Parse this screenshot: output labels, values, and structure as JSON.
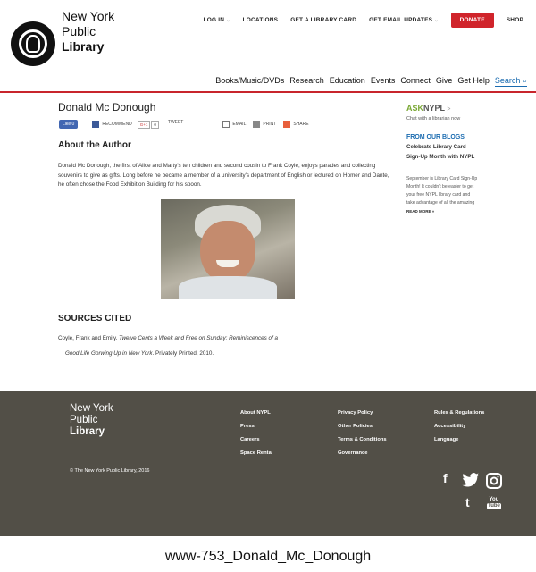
{
  "header": {
    "logo": {
      "line1": "New York",
      "line2": "Public",
      "line3": "Library"
    },
    "topnav": {
      "login": "LOG IN",
      "locations": "LOCATIONS",
      "library_card": "GET A LIBRARY CARD",
      "email_updates": "GET EMAIL UPDATES",
      "donate": "DONATE",
      "shop": "SHOP"
    },
    "mainnav": [
      "Books/Music/DVDs",
      "Research",
      "Education",
      "Events",
      "Connect",
      "Give",
      "Get Help"
    ],
    "search_label": "Search"
  },
  "page": {
    "title": "Donald Mc Donough",
    "share": {
      "like": "Like 0",
      "recommend": "RECOMMEND",
      "gplus": "G+1",
      "gplus_count": "0",
      "tweet": "TWEET",
      "email": "EMAIL",
      "print": "PRINT",
      "share": "SHARE"
    },
    "about_heading": "About the Author",
    "bio": "Donald Mc Donough, the first of Alice and Marty's ten children and second cousin to Frank Coyle, enjoys parades and collecting souvenirs to give as gifts. Long before he became a member of a university's department of English or lectured on Homer and Dante, he often chose the Food Exhibition Building for his spoon.",
    "sources_heading": "SOURCES CITED",
    "citation": {
      "authors": "Coyle, Frank and Emily.",
      "title_part1": "Twelve Cents a Week and Free on Sunday: Reminiscences of a",
      "title_part2": "Good Life Gorwing Up in New York",
      "rest": ". Privately Printed, 2010."
    }
  },
  "sidebar": {
    "ask_a": "ASK",
    "ask_b": "NYPL",
    "ask_arrow": ">",
    "ask_sub": "Chat with a librarian now",
    "blogs_heading": "FROM OUR BLOGS",
    "blog_title": "Celebrate Library Card Sign-Up Month with NYPL",
    "blog_body": "September is Library Card Sign-Up Month! It couldn't be easier to get your free NYPL library card and take advantage of all the amazing",
    "read_more": "READ MORE »"
  },
  "footer": {
    "logo": {
      "line1": "New York",
      "line2": "Public",
      "line3": "Library"
    },
    "col1": [
      "About NYPL",
      "Press",
      "Careers",
      "Space Rental"
    ],
    "col2": [
      "Privacy Policy",
      "Other Policies",
      "Terms & Conditions",
      "Governance"
    ],
    "col3": [
      "Rules & Regulations",
      "Accessibility",
      "Language"
    ],
    "copyright": "© The New York Public Library, 2016",
    "social": {
      "facebook": "f",
      "twitter": "t-bird",
      "instagram": "cam",
      "tumblr": "t",
      "youtube": "You Tube"
    }
  },
  "caption": "www-753_Donald_Mc_Donough",
  "colors": {
    "accent_red": "#d0242b",
    "link_blue": "#1a6bb0",
    "ask_green": "#7aa834",
    "footer_bg": "#524f47"
  }
}
